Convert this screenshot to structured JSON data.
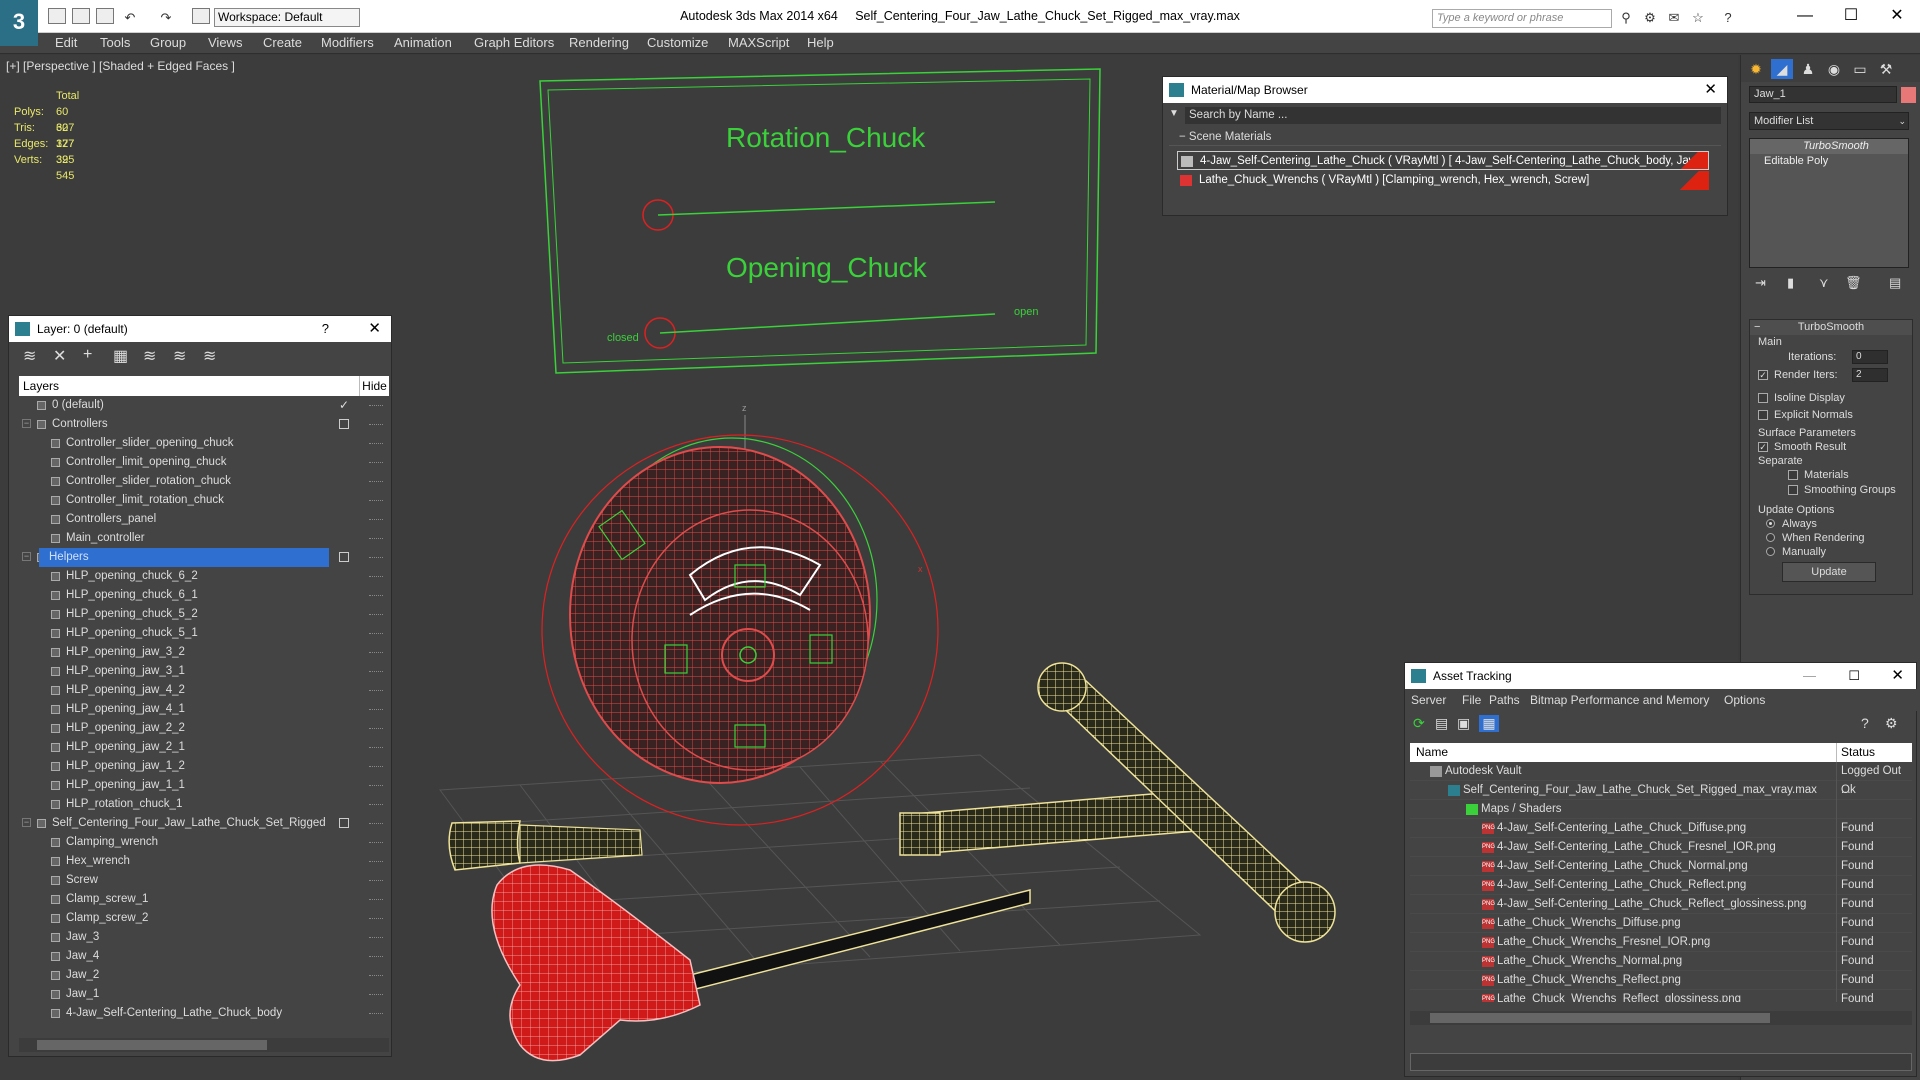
{
  "app": {
    "logo": "3",
    "title": "Autodesk 3ds Max  2014 x64",
    "filename": "Self_Centering_Four_Jaw_Lathe_Chuck_Set_Rigged_max_vray.max",
    "workspace": "Workspace: Default",
    "search_placeholder": "Type a keyword or phrase",
    "help": "?",
    "win_min": "—",
    "win_max": "☐",
    "win_close": "✕"
  },
  "menu": [
    "Edit",
    "Tools",
    "Group",
    "Views",
    "Create",
    "Modifiers",
    "Animation",
    "Graph Editors",
    "Rendering",
    "Customize",
    "MAXScript",
    "Help"
  ],
  "viewport": {
    "label": "[+] [Perspective ] [Shaded + Edged Faces ]",
    "stats_header": "Total",
    "stats": [
      {
        "label": "Polys:",
        "value": "60 327"
      },
      {
        "label": "Tris:",
        "value": "60 327"
      },
      {
        "label": "Edges:",
        "value": "177 395"
      },
      {
        "label": "Verts:",
        "value": "32 545"
      }
    ],
    "panel_labels": {
      "rotation": "Rotation_Chuck",
      "opening": "Opening_Chuck",
      "closed": "closed",
      "open": "open"
    },
    "axis": {
      "z": "z",
      "x": "x"
    }
  },
  "layer_panel": {
    "title": "Layer: 0 (default)",
    "help": "?",
    "close": "✕",
    "col_layers": "Layers",
    "col_hide": "Hide",
    "rows": [
      {
        "label": "0 (default)",
        "indent": 1,
        "check": "✓"
      },
      {
        "label": "Controllers",
        "indent": 1,
        "group": true,
        "box": true
      },
      {
        "label": "Controller_slider_opening_chuck",
        "indent": 2
      },
      {
        "label": "Controller_limit_opening_chuck",
        "indent": 2
      },
      {
        "label": "Controller_slider_rotation_chuck",
        "indent": 2
      },
      {
        "label": "Controller_limit_rotation_chuck",
        "indent": 2
      },
      {
        "label": "Controllers_panel",
        "indent": 2
      },
      {
        "label": "Main_controller",
        "indent": 2
      },
      {
        "label": "Helpers",
        "indent": 1,
        "group": true,
        "box": true,
        "selected": true
      },
      {
        "label": "HLP_opening_chuck_6_2",
        "indent": 2
      },
      {
        "label": "HLP_opening_chuck_6_1",
        "indent": 2
      },
      {
        "label": "HLP_opening_chuck_5_2",
        "indent": 2
      },
      {
        "label": "HLP_opening_chuck_5_1",
        "indent": 2
      },
      {
        "label": "HLP_opening_jaw_3_2",
        "indent": 2
      },
      {
        "label": "HLP_opening_jaw_3_1",
        "indent": 2
      },
      {
        "label": "HLP_opening_jaw_4_2",
        "indent": 2
      },
      {
        "label": "HLP_opening_jaw_4_1",
        "indent": 2
      },
      {
        "label": "HLP_opening_jaw_2_2",
        "indent": 2
      },
      {
        "label": "HLP_opening_jaw_2_1",
        "indent": 2
      },
      {
        "label": "HLP_opening_jaw_1_2",
        "indent": 2
      },
      {
        "label": "HLP_opening_jaw_1_1",
        "indent": 2
      },
      {
        "label": "HLP_rotation_chuck_1",
        "indent": 2
      },
      {
        "label": "Self_Centering_Four_Jaw_Lathe_Chuck_Set_Rigged",
        "indent": 1,
        "group": true,
        "box": true
      },
      {
        "label": "Clamping_wrench",
        "indent": 2
      },
      {
        "label": "Hex_wrench",
        "indent": 2
      },
      {
        "label": "Screw",
        "indent": 2
      },
      {
        "label": "Clamp_screw_1",
        "indent": 2
      },
      {
        "label": "Clamp_screw_2",
        "indent": 2
      },
      {
        "label": "Jaw_3",
        "indent": 2
      },
      {
        "label": "Jaw_4",
        "indent": 2
      },
      {
        "label": "Jaw_2",
        "indent": 2
      },
      {
        "label": "Jaw_1",
        "indent": 2
      },
      {
        "label": "4-Jaw_Self-Centering_Lathe_Chuck_body",
        "indent": 2
      }
    ]
  },
  "material_browser": {
    "title": "Material/Map Browser",
    "close": "✕",
    "search": "Search by Name ...",
    "section": "Scene Materials",
    "rows": [
      "4-Jaw_Self-Centering_Lathe_Chuck  ( VRayMtl ) [ 4-Jaw_Self-Centering_Lathe_Chuck_body,  Jaw...",
      "Lathe_Chuck_Wrenchs  ( VRayMtl ) [Clamping_wrench, Hex_wrench, Screw]"
    ]
  },
  "command_panel": {
    "object_name": "Jaw_1",
    "object_color": "#e87878",
    "modifier_list": "Modifier List",
    "stack": [
      "TurboSmooth",
      "Editable Poly"
    ],
    "rollout_title": "TurboSmooth",
    "main": "Main",
    "iterations_label": "Iterations:",
    "iterations": "0",
    "render_iters_label": "Render Iters:",
    "render_iters": "2",
    "isoline": "Isoline Display",
    "explicit": "Explicit Normals",
    "surface_params": "Surface Parameters",
    "smooth_result": "Smooth Result",
    "separate": "Separate",
    "materials": "Materials",
    "smoothing_groups": "Smoothing Groups",
    "update_options": "Update Options",
    "always": "Always",
    "when_rendering": "When Rendering",
    "manually": "Manually",
    "update": "Update"
  },
  "asset_tracking": {
    "title": "Asset Tracking",
    "menu": [
      "Server",
      "File",
      "Paths",
      "Bitmap Performance and Memory",
      "Options"
    ],
    "col_name": "Name",
    "col_status": "Status",
    "rows": [
      {
        "name": "Autodesk Vault",
        "status": "Logged Out ...",
        "level": 1,
        "icon": "vault"
      },
      {
        "name": "Self_Centering_Four_Jaw_Lathe_Chuck_Set_Rigged_max_vray.max",
        "status": "Ok",
        "level": 2,
        "icon": "max"
      },
      {
        "name": "Maps / Shaders",
        "status": "",
        "level": 3,
        "icon": "folder"
      },
      {
        "name": "4-Jaw_Self-Centering_Lathe_Chuck_Diffuse.png",
        "status": "Found",
        "level": 4,
        "icon": "png"
      },
      {
        "name": "4-Jaw_Self-Centering_Lathe_Chuck_Fresnel_IOR.png",
        "status": "Found",
        "level": 4,
        "icon": "png"
      },
      {
        "name": "4-Jaw_Self-Centering_Lathe_Chuck_Normal.png",
        "status": "Found",
        "level": 4,
        "icon": "png"
      },
      {
        "name": "4-Jaw_Self-Centering_Lathe_Chuck_Reflect.png",
        "status": "Found",
        "level": 4,
        "icon": "png"
      },
      {
        "name": "4-Jaw_Self-Centering_Lathe_Chuck_Reflect_glossiness.png",
        "status": "Found",
        "level": 4,
        "icon": "png"
      },
      {
        "name": "Lathe_Chuck_Wrenchs_Diffuse.png",
        "status": "Found",
        "level": 4,
        "icon": "png"
      },
      {
        "name": "Lathe_Chuck_Wrenchs_Fresnel_IOR.png",
        "status": "Found",
        "level": 4,
        "icon": "png"
      },
      {
        "name": "Lathe_Chuck_Wrenchs_Normal.png",
        "status": "Found",
        "level": 4,
        "icon": "png"
      },
      {
        "name": "Lathe_Chuck_Wrenchs_Reflect.png",
        "status": "Found",
        "level": 4,
        "icon": "png"
      },
      {
        "name": "Lathe_Chuck_Wrenchs_Reflect_glossiness.png",
        "status": "Found",
        "level": 4,
        "icon": "png"
      }
    ],
    "png_badge": "PNG"
  }
}
